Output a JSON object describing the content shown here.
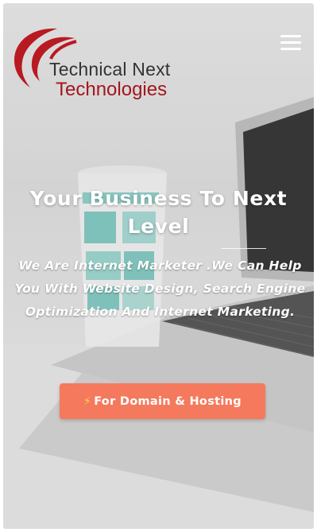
{
  "header": {
    "logo": {
      "line1": "Technical Next",
      "line2": "Technologies",
      "colors": {
        "text_dark": "#333333",
        "brand_red": "#a3161d"
      }
    },
    "menu_icon": "hamburger-menu-icon"
  },
  "hero": {
    "title": "Your Business To Next Level",
    "subtitle": "We Are Internet Marketer .We Can Help You With Website Design, Search Engine Optimization And Internet Marketing.",
    "cta": {
      "icon": "lightning-bolt-icon",
      "label": "For Domain & Hosting",
      "color": "#f5795d"
    },
    "background": "laptop-and-coffee-cup-photo"
  }
}
